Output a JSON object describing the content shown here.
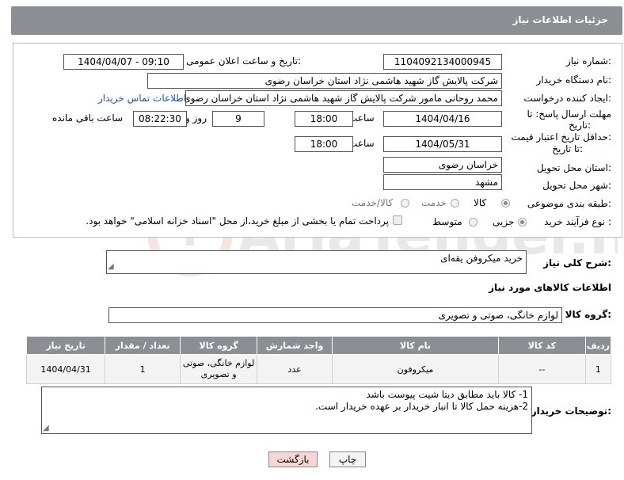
{
  "header": {
    "title": "جزئیات اطلاعات نیاز"
  },
  "form": {
    "need_number": {
      "label": "شماره نیاز:",
      "value": "1104092134000945"
    },
    "announce_datetime": {
      "label": "تاریخ و ساعت اعلان عمومی:",
      "value": "1404/04/07 - 09:10"
    },
    "buyer_org": {
      "label": "نام دستگاه خریدار:",
      "value": "شرکت پالایش گاز شهید هاشمی نژاد   استان خراسان رضوی"
    },
    "requester": {
      "label": "ایجاد کننده درخواست:",
      "value": "محمد روحانی مامور  شرکت پالایش گاز شهید هاشمی نژاد   استان خراسان رضوی"
    },
    "buyer_contact_link": "اطلاعات تماس خریدار",
    "reply_deadline": {
      "label_line1": "مهلت ارسال پاسخ: تا",
      "label_line2": "تاریخ:",
      "date": "1404/04/16",
      "time_label": "ساعت",
      "time": "18:00",
      "days": "9",
      "days_label": "روز و",
      "remaining": "08:22:30",
      "remaining_label": "ساعت باقی مانده"
    },
    "price_validity": {
      "label_line1": "حداقل تاریخ اعتبار قیمت:",
      "label_line2": "تا تاریخ:",
      "date": "1404/05/31",
      "time_label": "ساعت",
      "time": "18:00"
    },
    "delivery_province": {
      "label": "استان محل تحویل:",
      "value": "خراسان رضوی"
    },
    "delivery_city": {
      "label": "شهر محل تحویل:",
      "value": "مشهد"
    },
    "category": {
      "label": "طبقه بندی موضوعی:",
      "options": [
        "کالا",
        "خدمت",
        "کالا/خدمت"
      ],
      "selected": "کالا"
    },
    "process_type": {
      "label": "نوع فرآیند خرید :",
      "options": [
        "جزیی",
        "متوسط"
      ],
      "selected": "جزیی",
      "note": "پرداخت تمام یا بخشی از مبلغ خرید،از محل \"اسناد خزانه اسلامی\" خواهد بود."
    }
  },
  "summary": {
    "label": "شرح کلی نیاز:",
    "value": "خرید میکروفن یقه‌ای"
  },
  "goods_section": {
    "title": "اطلاعات کالاهای مورد نیاز"
  },
  "goods_group": {
    "label": "گروه کالا:",
    "value": "لوازم خانگی، صوتی و تصویری"
  },
  "table": {
    "headers": [
      "ردیف",
      "کد کالا",
      "نام کالا",
      "واحد شمارش",
      "گروه کالا",
      "تعداد / مقدار",
      "تاریخ نیاز"
    ],
    "rows": [
      [
        "1",
        "--",
        "میکروفون",
        "عدد",
        "لوازم خانگی، صوتی و تصویری",
        "1",
        "1404/04/31"
      ]
    ]
  },
  "buyer_notes": {
    "label": "توضیحات خریدار:",
    "line1": "1- کالا باید مطابق دیتا شیت پیوست باشد",
    "line2": "2-هزینه حمل کالا تا انبار خریدار بر عهده خریدار است."
  },
  "buttons": {
    "print": "چاپ",
    "back": "بازگشت"
  },
  "watermark": {
    "text": "AriaTender.net"
  },
  "colors": {
    "header_bg": "#8b8e92",
    "link": "#1a56b0",
    "back_btn_bg": "#f7d6d6"
  }
}
